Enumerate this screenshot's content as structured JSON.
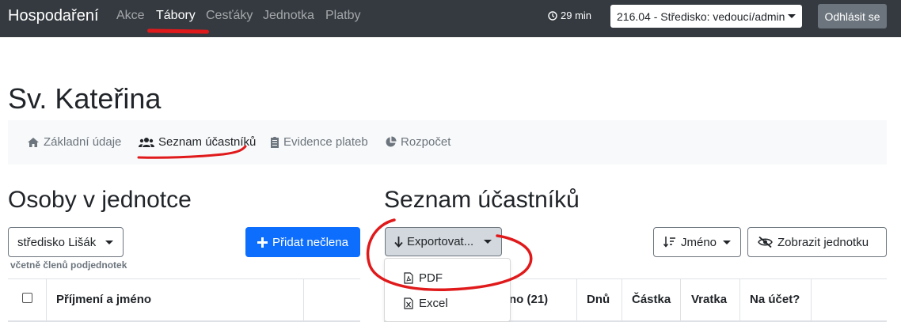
{
  "navbar": {
    "brand": "Hospodaření",
    "links": [
      {
        "label": "Akce",
        "active": false
      },
      {
        "label": "Tábory",
        "active": true
      },
      {
        "label": "Cesťáky",
        "active": false
      },
      {
        "label": "Jednotka",
        "active": false
      },
      {
        "label": "Platby",
        "active": false
      }
    ],
    "timer": "29 min",
    "role": "216.04 - Středisko: vedoucí/admin",
    "logout": "Odhlásit se"
  },
  "page": {
    "title": "Sv. Kateřina"
  },
  "tabs": [
    {
      "label": "Základní údaje",
      "icon": "home-icon",
      "active": false
    },
    {
      "label": "Seznam účastníků",
      "icon": "users-icon",
      "active": true
    },
    {
      "label": "Evidence plateb",
      "icon": "clipboard-icon",
      "active": false
    },
    {
      "label": "Rozpočet",
      "icon": "pie-chart-icon",
      "active": false
    }
  ],
  "left": {
    "heading": "Osoby v jednotce",
    "unit_select": "středisko Lišák",
    "add_button": "Přidat nečlena",
    "subnote": "včetně členů podjednotek",
    "column_name": "Příjmení a jméno"
  },
  "right": {
    "heading": "Seznam účastníků",
    "export_button": "Exportovat...",
    "export_options": [
      "PDF",
      "Excel"
    ],
    "sort_button": "Jméno",
    "toggle_unit_button": "Zobrazit jednotku",
    "columns": {
      "name_partial": "no (21)",
      "days": "Dnů",
      "amount": "Částka",
      "refund": "Vratka",
      "to_account": "Na účet?"
    }
  },
  "colors": {
    "navbar_bg": "#343a40",
    "primary": "#0d6efd",
    "annotation_red": "#e0191b"
  }
}
